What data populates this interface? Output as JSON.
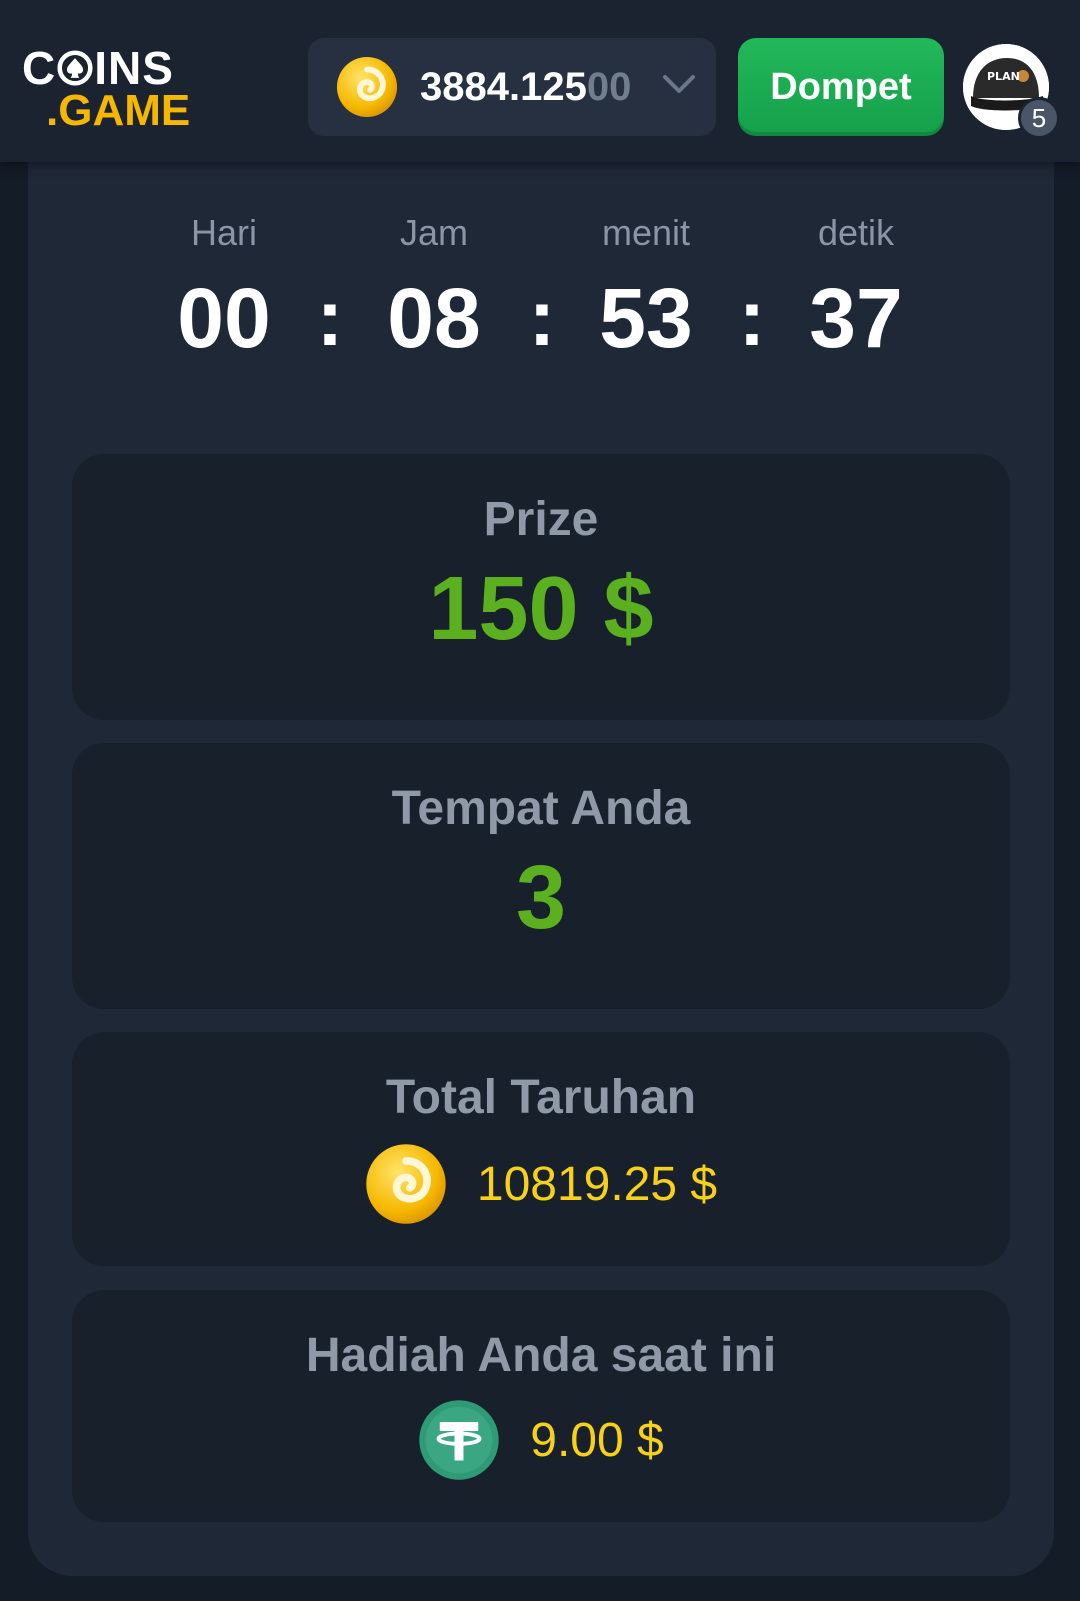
{
  "header": {
    "logo": {
      "top": "C♠INS",
      "bottom": ".GAME"
    },
    "balance": {
      "main": "3884.125",
      "dim": "00",
      "icon": "coin-icon",
      "chevron": "chevron-down-icon"
    },
    "wallet_button": "Dompet",
    "avatar": {
      "cap_text": "PLAN",
      "badge": "5"
    }
  },
  "countdown": {
    "labels": {
      "days": "Hari",
      "hours": "Jam",
      "minutes": "menit",
      "seconds": "detik"
    },
    "values": {
      "days": "00",
      "hours": "08",
      "minutes": "53",
      "seconds": "37"
    },
    "separator": ":"
  },
  "cards": {
    "prize": {
      "title": "Prize",
      "value": "150 $"
    },
    "place": {
      "title": "Tempat Anda",
      "value": "3"
    },
    "total_bet": {
      "title": "Total Taruhan",
      "value": "10819.25 $",
      "icon": "coin-icon"
    },
    "current_reward": {
      "title": "Hadiah Anda saat ini",
      "value": "9.00 $",
      "icon": "tether-icon"
    }
  },
  "colors": {
    "background": "#141c27",
    "header": "#1b2331",
    "panel": "#1f2837",
    "card": "#18202c",
    "accent_green": "#5ab01f",
    "wallet_green": "#1fb356",
    "yellow": "#f7d117",
    "logo_yellow": "#f5b700",
    "tether": "#3aa782"
  }
}
